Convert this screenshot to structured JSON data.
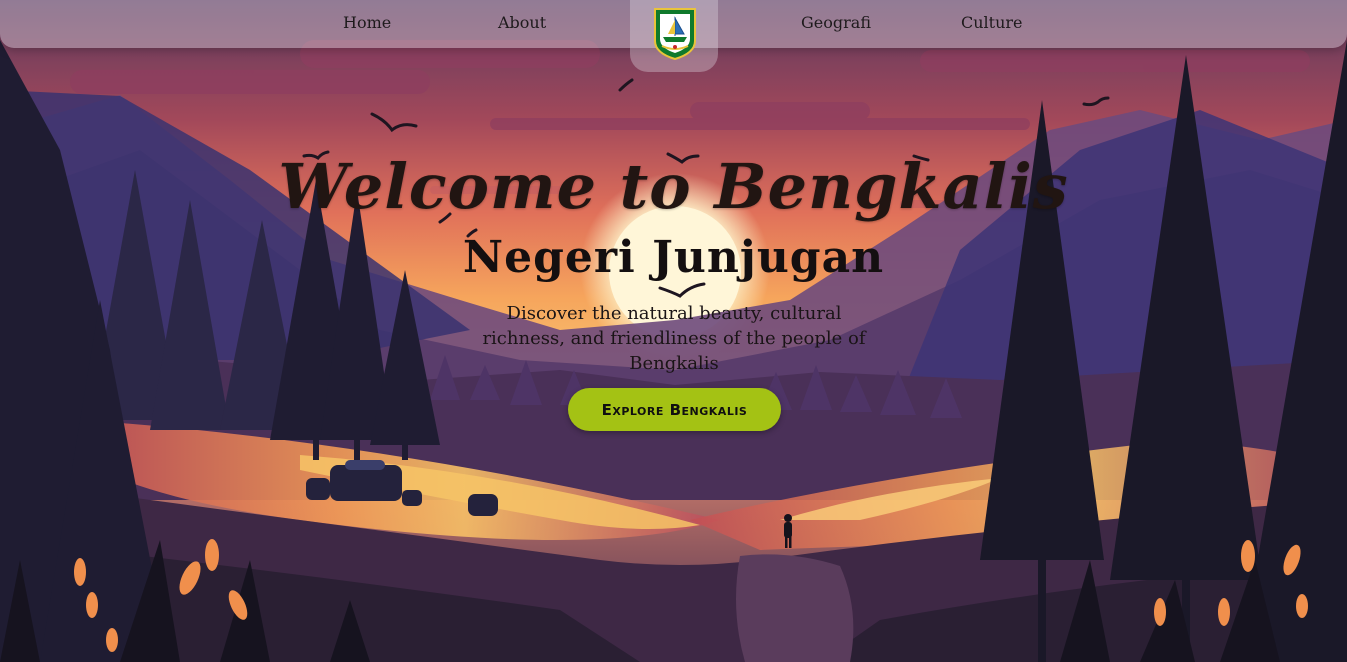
{
  "nav": {
    "home": "Home",
    "about": "About",
    "geografi": "Geografi",
    "culture": "Culture",
    "logo_icon": "bengkalis-emblem-icon"
  },
  "hero": {
    "title": "Welcome to Bengkalis",
    "subtitle": "Negeri Junjugan",
    "description": "Discover the natural beauty, cultural richness, and friendliness of the people of Bengkalis",
    "cta_label": "Explore Bengkalis"
  },
  "colors": {
    "cta_background": "#a4c214",
    "sky_top": "#6b3d64",
    "sky_glow": "#f7b15f",
    "sun": "#fdf3cf",
    "forest_dark": "#1d1a2c"
  }
}
